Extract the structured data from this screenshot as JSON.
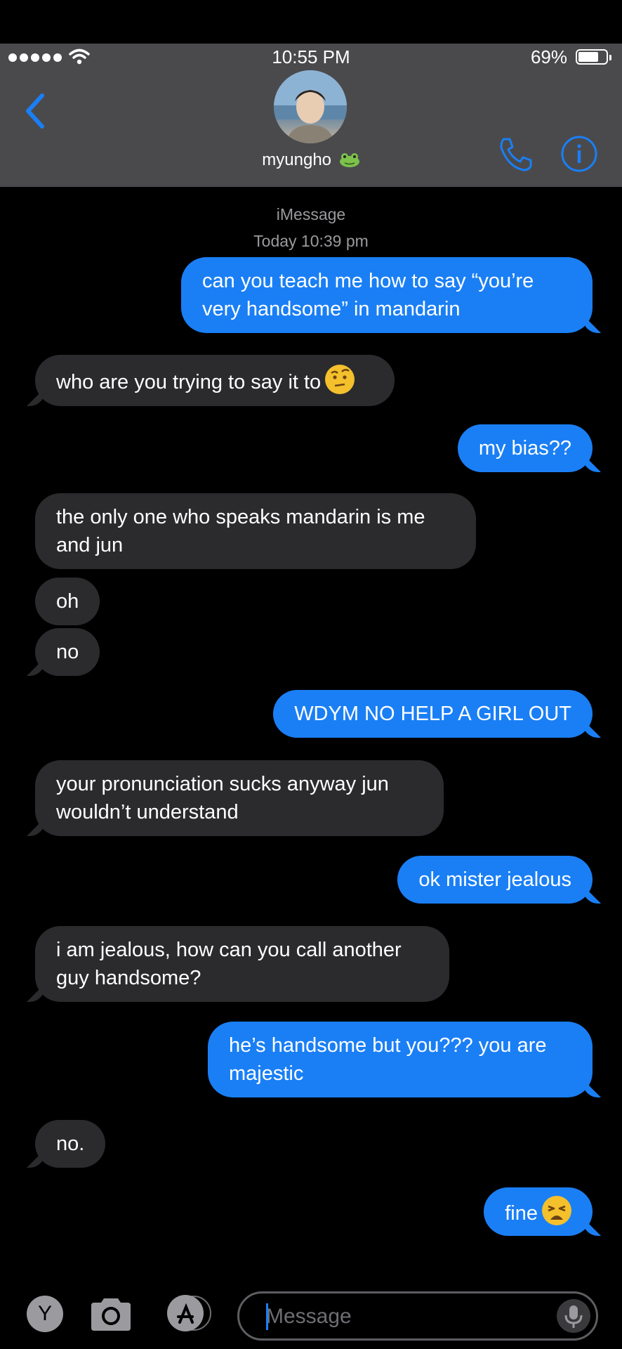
{
  "status_bar": {
    "time": "10:55 PM",
    "battery": "69%",
    "battery_level": 0.69,
    "signal_bars": 5
  },
  "header": {
    "contact_name": "myungho",
    "name_emoji": "frog-emoji",
    "back_icon": "chevron-left-icon",
    "call_icon": "phone-icon",
    "info_icon": "info-icon"
  },
  "thread": {
    "service_label": "iMessage",
    "timestamp": "Today 10:39 pm",
    "messages": [
      {
        "direction": "sent",
        "text": "can you teach me how to say “you’re",
        "text2": "very handsome” in mandarin"
      },
      {
        "direction": "received",
        "text": "who are you trying to say it to",
        "emoji": "raised-eyebrow-emoji"
      },
      {
        "direction": "sent",
        "text": "my bias??"
      },
      {
        "direction": "received",
        "text": "the only one who speaks mandarin is me",
        "text2": "and jun"
      },
      {
        "direction": "received",
        "text": "oh"
      },
      {
        "direction": "received",
        "text": "no"
      },
      {
        "direction": "sent",
        "text": "WDYM NO HELP A GIRL OUT"
      },
      {
        "direction": "received",
        "text": "your pronunciation sucks anyway jun",
        "text2": "wouldn’t understand"
      },
      {
        "direction": "sent",
        "text": "ok mister jealous"
      },
      {
        "direction": "received",
        "text": "i am jealous, how can you call another",
        "text2": "guy handsome?"
      },
      {
        "direction": "sent",
        "text": "he’s handsome but you??? you are",
        "text2": "majestic"
      },
      {
        "direction": "received",
        "text": "no."
      },
      {
        "direction": "sent",
        "text": "fine",
        "emoji": "tired-face-emoji"
      }
    ]
  },
  "compose": {
    "app_button_label": "Y",
    "placeholder": "Message",
    "camera_icon": "camera-icon",
    "apps_icon": "app-store-icon",
    "mic_icon": "microphone-icon"
  },
  "colors": {
    "sent_bubble": "#1a7ff5",
    "received_bubble": "#2b2b2e",
    "header_bg": "#4a4a4d",
    "accent": "#1a7ff5"
  }
}
